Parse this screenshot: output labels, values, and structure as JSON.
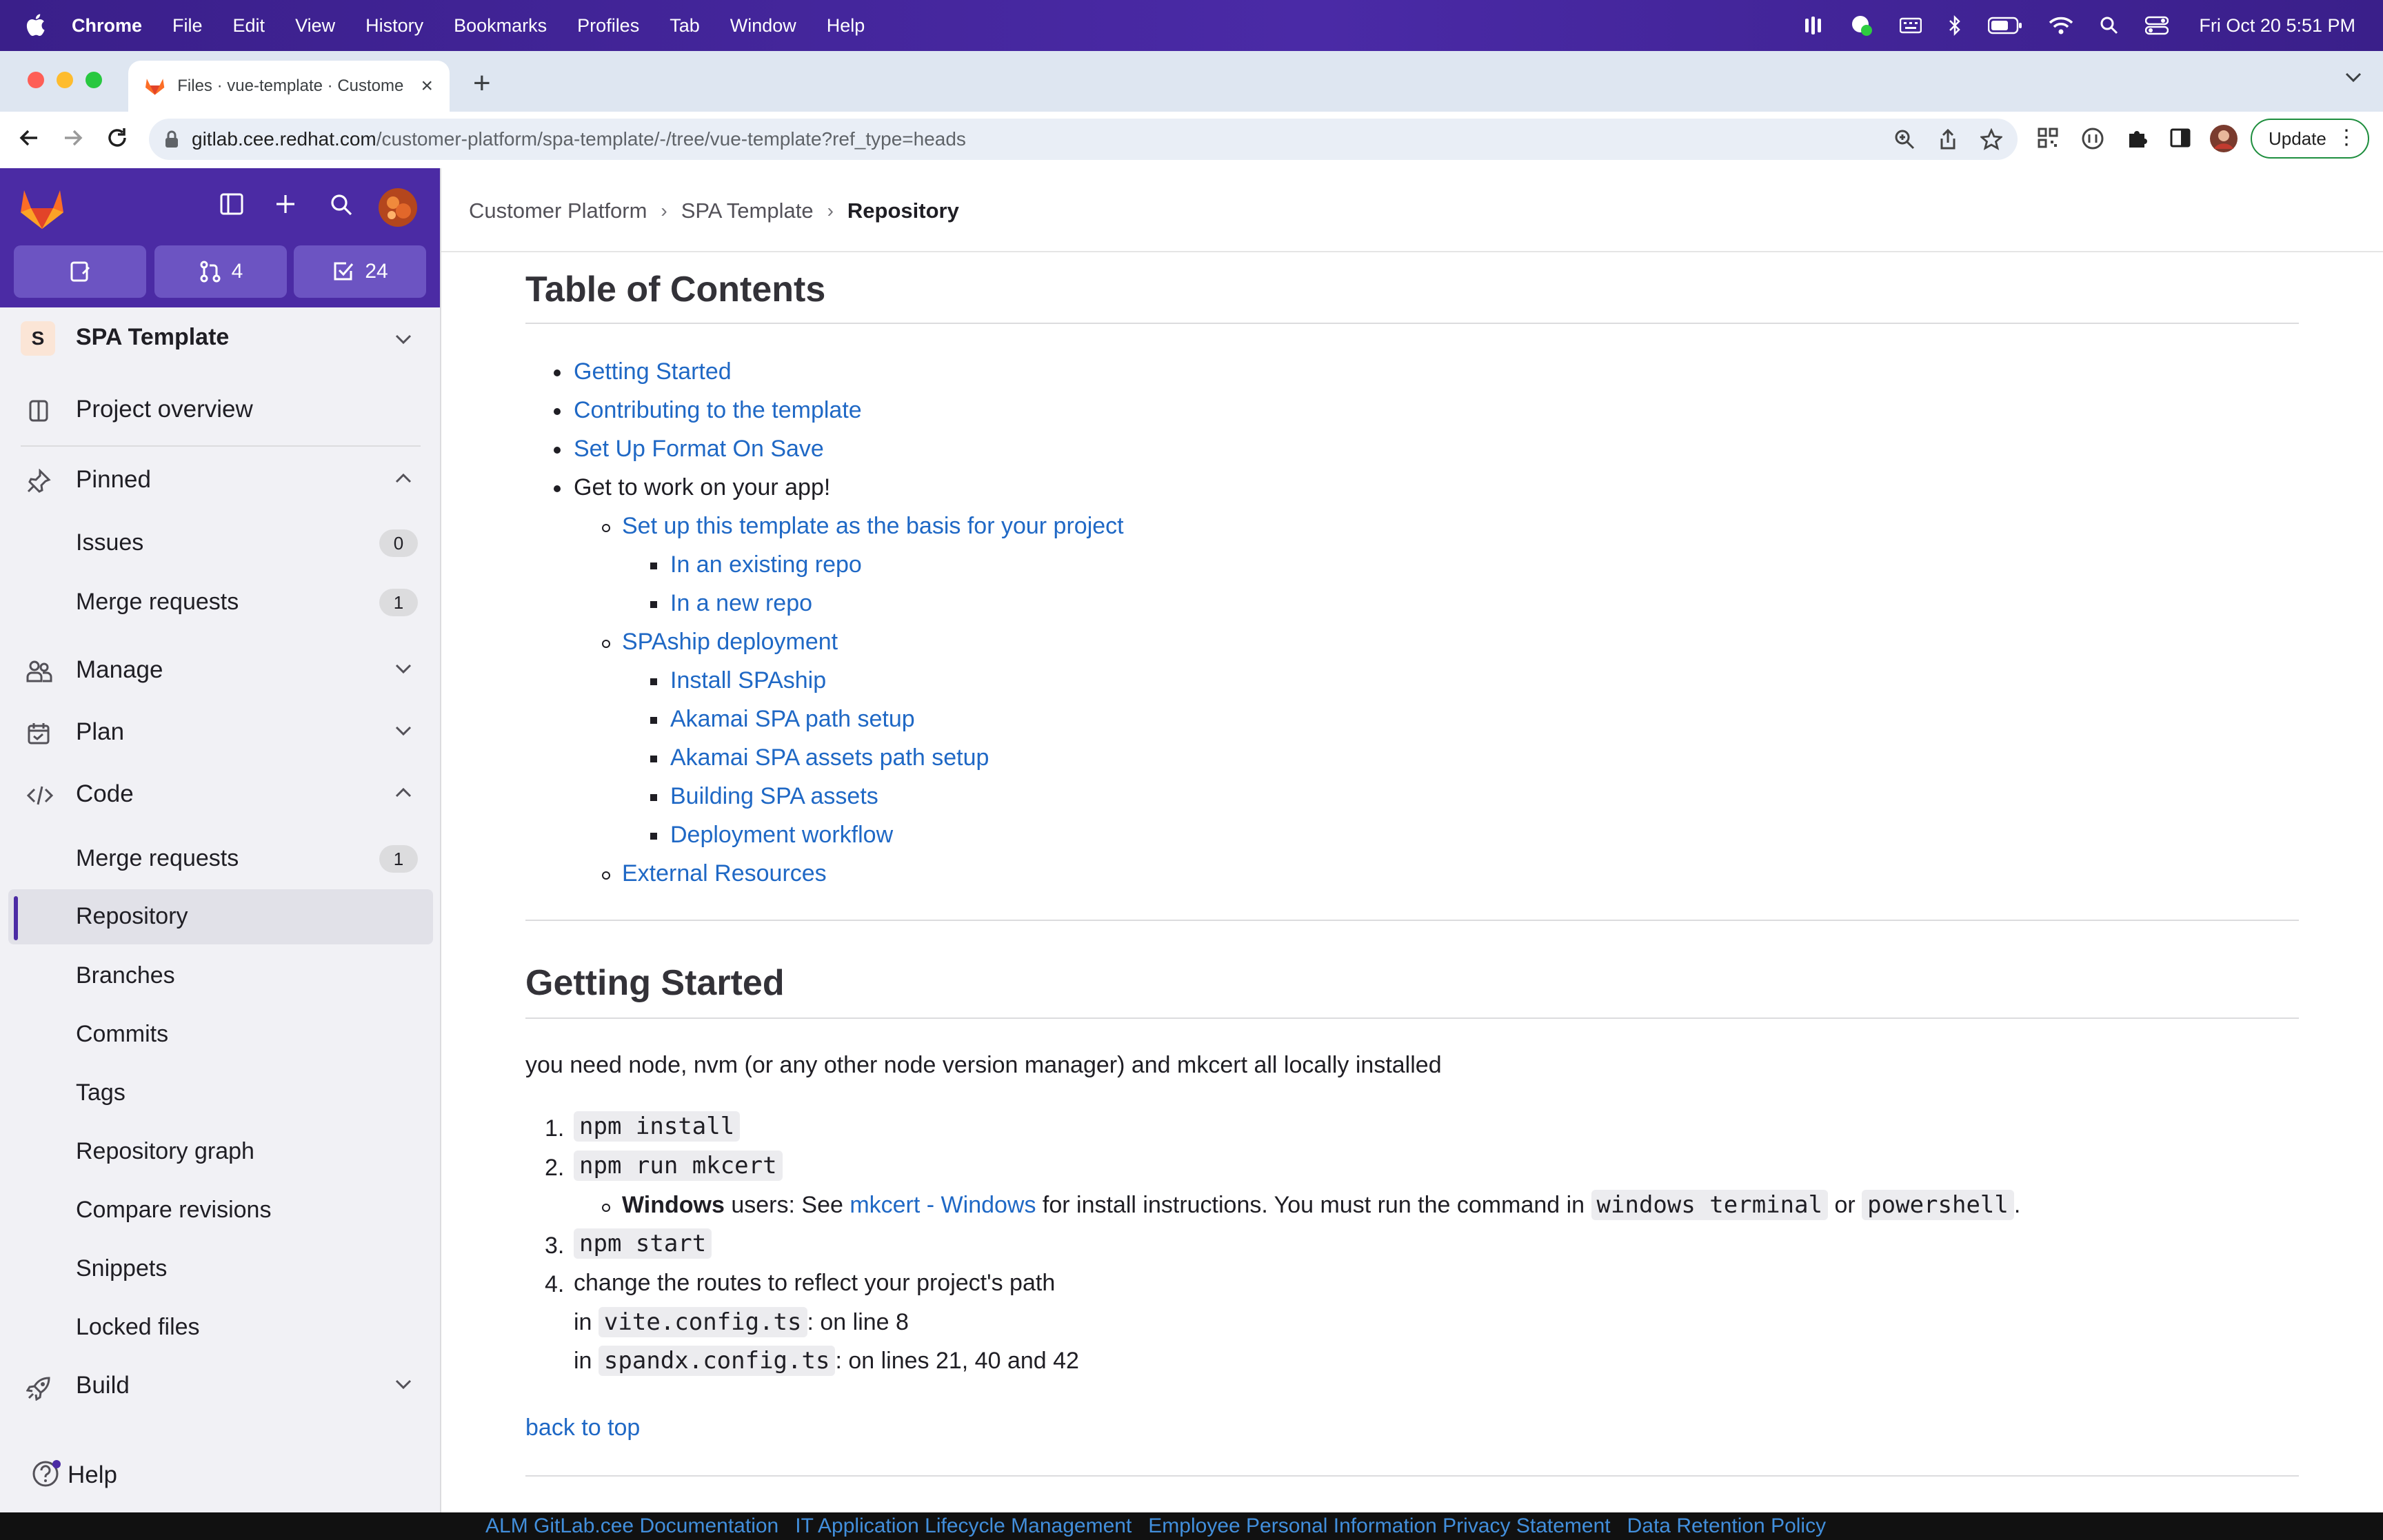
{
  "menubar": {
    "app": "Chrome",
    "menus": [
      "File",
      "Edit",
      "View",
      "History",
      "Bookmarks",
      "Profiles",
      "Tab",
      "Window",
      "Help"
    ],
    "clock": "Fri Oct 20  5:51 PM"
  },
  "browser": {
    "tab_title": "Files · vue-template · Custome",
    "url_host": "gitlab.cee.redhat.com",
    "url_path": "/customer-platform/spa-template/-/tree/vue-template?ref_type=heads",
    "update_label": "Update"
  },
  "sidebar": {
    "counters": {
      "merge_requests": "4",
      "todos": "24"
    },
    "project_avatar": "S",
    "project_name": "SPA Template",
    "project_overview": "Project overview",
    "pinned": "Pinned",
    "pinned_items": [
      {
        "label": "Issues",
        "count": "0"
      },
      {
        "label": "Merge requests",
        "count": "1"
      }
    ],
    "manage": "Manage",
    "plan": "Plan",
    "code": "Code",
    "code_items": [
      {
        "label": "Merge requests",
        "count": "1"
      },
      {
        "label": "Repository"
      },
      {
        "label": "Branches"
      },
      {
        "label": "Commits"
      },
      {
        "label": "Tags"
      },
      {
        "label": "Repository graph"
      },
      {
        "label": "Compare revisions"
      },
      {
        "label": "Snippets"
      },
      {
        "label": "Locked files"
      }
    ],
    "build": "Build",
    "help": "Help"
  },
  "breadcrumb": [
    "Customer Platform",
    "SPA Template",
    "Repository"
  ],
  "readme": {
    "toc_heading": "Table of Contents",
    "toc": {
      "getting_started": "Getting Started",
      "contributing": "Contributing to the template",
      "format_on_save": "Set Up Format On Save",
      "get_to_work": "Get to work on your app!",
      "setup_template": "Set up this template as the basis for your project",
      "existing_repo": "In an existing repo",
      "new_repo": "In a new repo",
      "spaship_deployment": "SPAship deployment",
      "install_spaship": "Install SPAship",
      "akamai_path": "Akamai SPA path setup",
      "akamai_assets": "Akamai SPA assets path setup",
      "building_assets": "Building SPA assets",
      "deployment_workflow": "Deployment workflow",
      "external_resources": "External Resources"
    },
    "getting_started_heading": "Getting Started",
    "intro": "you need node, nvm (or any other node version manager) and mkcert all locally installed",
    "steps": {
      "n1": "1.",
      "n2": "2.",
      "n3": "3.",
      "n4": "4.",
      "s1_code": "npm install",
      "s2_code": "npm run mkcert",
      "windows_bold": "Windows",
      "windows_a": " users: See ",
      "windows_link": "mkcert - Windows",
      "windows_b": " for install instructions. You must run the command in ",
      "windows_code1": "windows terminal",
      "windows_or": " or ",
      "windows_code2": "powershell",
      "windows_end": ".",
      "s3_code": "npm start",
      "s4_text": "change the routes to reflect your project's path",
      "in_word": "in",
      "vite_code": "vite.config.ts",
      "vite_tail": ": on line 8",
      "spandx_code": "spandx.config.ts",
      "spandx_tail": ": on lines 21, 40 and 42"
    },
    "back_to_top": "back to top"
  },
  "footer": [
    "ALM GitLab.cee Documentation",
    "IT Application Lifecycle Management",
    "Employee Personal Information Privacy Statement",
    "Data Retention Policy"
  ],
  "colors": {
    "gitlab_purple": "#4b2ba4",
    "link": "#1f68c5",
    "sidebar_bg": "#f1f1f5"
  }
}
